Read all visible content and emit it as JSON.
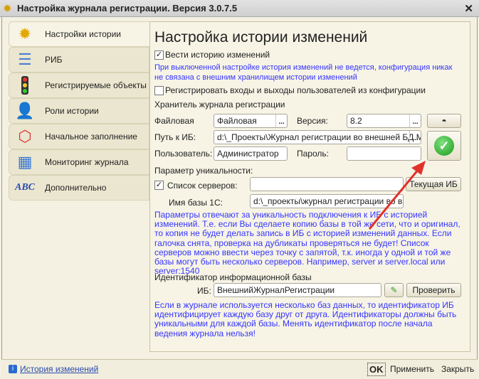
{
  "window": {
    "title": "Настройка журнала регистрации. Версия 3.0.7.5",
    "close": "✕"
  },
  "nav": [
    {
      "label": "Настройки истории",
      "icon": "gear-icon"
    },
    {
      "label": "РИБ",
      "icon": "tree-icon"
    },
    {
      "label": "Регистрируемые объекты",
      "icon": "traffic-light-icon"
    },
    {
      "label": "Роли истории",
      "icon": "user-lock-icon"
    },
    {
      "label": "Начальное заполнение",
      "icon": "molecule-icon"
    },
    {
      "label": "Мониторинг журнала",
      "icon": "calendar-icon"
    },
    {
      "label": "Дополнительно",
      "icon": "abc-palette-icon"
    }
  ],
  "main": {
    "title": "Настройка истории изменений",
    "keep_history": "Вести историю изменений",
    "keep_history_hint": "При выключенной настройке история изменений не ведется, конфигурация никак не связана с внешним хранилищем истории изменений",
    "register_logins": "Регистрировать входы и выходы пользователей из конфигурации",
    "storage_header": "Хранитель журнала регистрации",
    "type_label": "Файловая",
    "type_value": "Файловая",
    "version_label": "Версия:",
    "version_value": "8.2",
    "path_label": "Путь к ИБ:",
    "path_value": "d:\\_Проекты\\Журнал регистрации во внешней БД М...",
    "user_label": "Пользователь:",
    "user_value": "Администратор",
    "password_label": "Пароль:",
    "password_value": "",
    "ellipsis": "...",
    "uniq_header": "Параметр уникальности:",
    "servers_label": "Список серверов:",
    "servers_value": "",
    "current_ib": "Текущая ИБ",
    "base_name_label": "Имя базы 1С:",
    "base_name_value": "d:\\_проекты\\журнал регистрации во внеш",
    "uniq_hint": "Параметры отвечают за уникальность подключения к ИБ с историей изменений. Т.е. если Вы сделаете копию базы в той же сети, что и оригинал, то копия не будет делать запись в ИБ с историей изменений данных. Если галочка снята, проверка на дубликаты проверяться не будет! Список серверов можно ввести через точку с запятой, т.к. иногда у одной и той же базы могут быть несколько серверов. Например, server и server.local или server:1540",
    "id_header": "Идентификатор информационной базы",
    "ib_label": "ИБ:",
    "ib_value": "ВнешнийЖурналРегистрации",
    "check": "Проверить",
    "id_hint": "Если в журнале используется несколько баз данных, то идентификатор ИБ идентифицирует каждую базу друг от друга. Идентификаторы должны быть уникальными для каждой базы. Менять идентификатор после начала ведения журнала нельзя!"
  },
  "footer": {
    "history_link": "История изменений",
    "ok": "OK",
    "apply": "Применить",
    "close": "Закрыть"
  },
  "colors": {
    "hint": "#3535ff",
    "arrow": "#e0332b"
  }
}
